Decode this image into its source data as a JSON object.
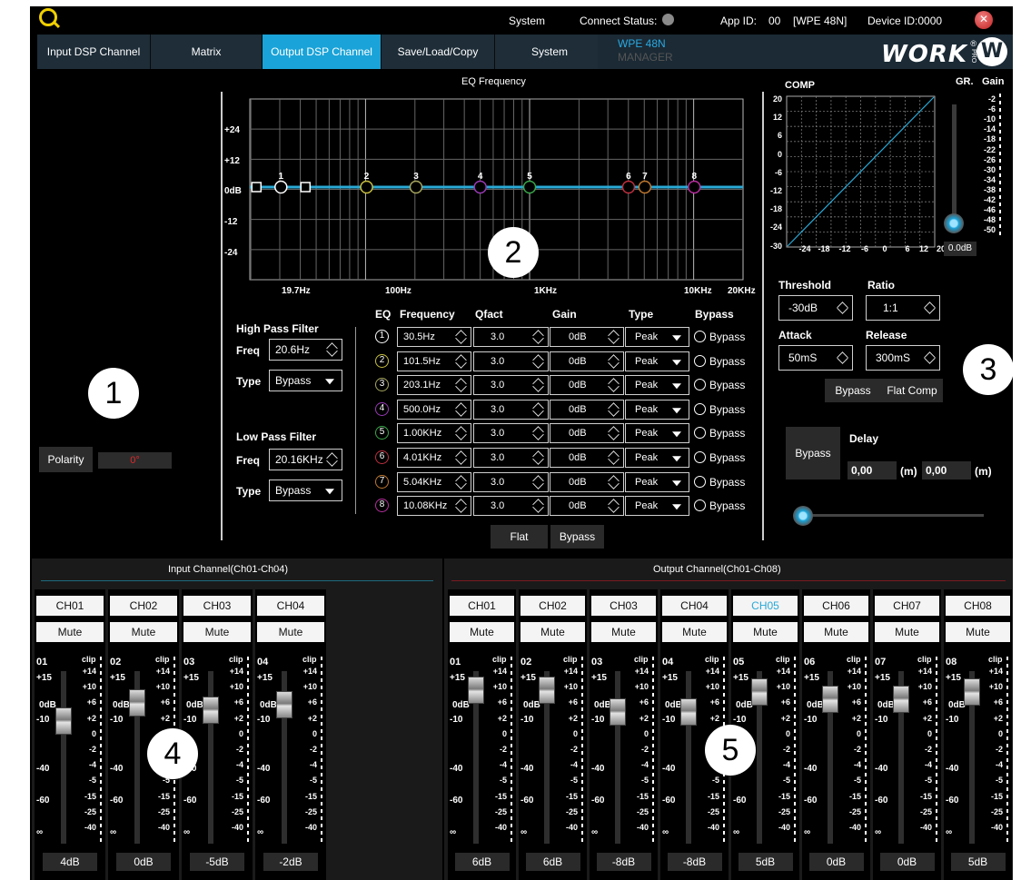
{
  "header": {
    "system_label": "System",
    "connect_status_label": "Connect  Status:",
    "app_id_label": "App ID:",
    "app_id_value": "00",
    "model_value": "[WPE 48N]",
    "device_id_label": "Device ID:0000",
    "close_glyph": "✕",
    "connect_status_color": "#8a8a8a"
  },
  "tabs": [
    {
      "label": "Input DSP Channel"
    },
    {
      "label": "Matrix"
    },
    {
      "label": "Output DSP Channel"
    },
    {
      "label": "Save/Load/Copy"
    },
    {
      "label": "System"
    }
  ],
  "active_tab": "Output DSP Channel",
  "product": {
    "name": "WPE 48N",
    "subtitle": "MANAGER",
    "brand": "WORK",
    "brand_pro": "PRO",
    "brand_reg": "®",
    "brand_badge": "W"
  },
  "colors": {
    "accent": "#1aa3d8",
    "eq_curve": "#29a9d6",
    "active_channel": "#29a9d6"
  },
  "callouts": [
    "1",
    "2",
    "3",
    "4",
    "5"
  ],
  "polarity": {
    "label": "Polarity",
    "value": "0°"
  },
  "eq_graph": {
    "title": "EQ Frequency",
    "y_labels": [
      "+24",
      "+12",
      "0dB",
      "-12",
      "-24"
    ],
    "x_labels": [
      "19.7Hz",
      "100Hz",
      "1KHz",
      "10KHz",
      "20KHz"
    ]
  },
  "high_pass": {
    "title": "High Pass Filter",
    "freq_label": "Freq",
    "freq": "20.6Hz",
    "type_label": "Type",
    "type": "Bypass"
  },
  "low_pass": {
    "title": "Low Pass Filter",
    "freq_label": "Freq",
    "freq": "20.16KHz",
    "type_label": "Type",
    "type": "Bypass"
  },
  "eq_table": {
    "headers": {
      "eq": "EQ",
      "frequency": "Frequency",
      "qfact": "Qfact",
      "gain": "Gain",
      "type": "Type",
      "bypass": "Bypass"
    },
    "bypass_label": "Bypass",
    "bands": [
      {
        "num": "1",
        "freq": "30.5Hz",
        "q": "3.0",
        "gain": "0dB",
        "type": "Peak",
        "color": "#ffffff"
      },
      {
        "num": "2",
        "freq": "101.5Hz",
        "q": "3.0",
        "gain": "0dB",
        "type": "Peak",
        "color": "#c8c040"
      },
      {
        "num": "3",
        "freq": "203.1Hz",
        "q": "3.0",
        "gain": "0dB",
        "type": "Peak",
        "color": "#a8a860"
      },
      {
        "num": "4",
        "freq": "500.0Hz",
        "q": "3.0",
        "gain": "0dB",
        "type": "Peak",
        "color": "#9a3ab8"
      },
      {
        "num": "5",
        "freq": "1.00KHz",
        "q": "3.0",
        "gain": "0dB",
        "type": "Peak",
        "color": "#3aa84a"
      },
      {
        "num": "6",
        "freq": "4.01KHz",
        "q": "3.0",
        "gain": "0dB",
        "type": "Peak",
        "color": "#c03040"
      },
      {
        "num": "7",
        "freq": "5.04KHz",
        "q": "3.0",
        "gain": "0dB",
        "type": "Peak",
        "color": "#c07830"
      },
      {
        "num": "8",
        "freq": "10.08KHz",
        "q": "3.0",
        "gain": "0dB",
        "type": "Peak",
        "color": "#b82fa0"
      }
    ],
    "flat_label": "Flat",
    "bypass_button": "Bypass"
  },
  "comp": {
    "title": "COMP",
    "y_labels": [
      "20",
      "12",
      "6",
      "0",
      "-6",
      "-12",
      "-18",
      "-24",
      "-30"
    ],
    "x_labels": [
      "-24",
      "-18",
      "-12",
      "-6",
      "0",
      "6",
      "12",
      "20"
    ],
    "gr_label": "GR.",
    "gain_label": "Gain",
    "gain_scale": [
      "-2",
      "-6",
      "-10",
      "-14",
      "-18",
      "-22",
      "-26",
      "-30",
      "-34",
      "-38",
      "-42",
      "-46",
      "-48",
      "-50"
    ],
    "gain_value": "0.0dB",
    "gain_fraction": 0.0,
    "threshold_label": "Threshold",
    "threshold": "-30dB",
    "ratio_label": "Ratio",
    "ratio": "1:1",
    "attack_label": "Attack",
    "attack": "50mS",
    "release_label": "Release",
    "release": "300mS",
    "bypass_label": "Bypass",
    "flat_comp_label": "Flat Comp"
  },
  "delay": {
    "bypass_label": "Bypass",
    "label": "Delay",
    "value1": "0,00",
    "unit1": "(m)",
    "value2": "0,00",
    "unit2": "(m)",
    "slider_fraction": 0.0
  },
  "fader_scale": {
    "left": [
      "+15",
      "0dB",
      "-10",
      "-40",
      "-60",
      "∞"
    ],
    "clip_label": "clip",
    "meter": [
      "+14",
      "+10",
      "+6",
      "+2",
      "0",
      "-2",
      "-4",
      "-5",
      "-15",
      "-25",
      "-40"
    ]
  },
  "input_section": {
    "title": "Input Channel(Ch01-Ch04)",
    "channels": [
      {
        "name": "CH01",
        "mute": "Mute",
        "num": "01",
        "level": "4dB"
      },
      {
        "name": "CH02",
        "mute": "Mute",
        "num": "02",
        "level": "0dB"
      },
      {
        "name": "CH03",
        "mute": "Mute",
        "num": "03",
        "level": "-5dB"
      },
      {
        "name": "CH04",
        "mute": "Mute",
        "num": "04",
        "level": "-2dB"
      }
    ]
  },
  "output_section": {
    "title": "Output Channel(Ch01-Ch08)",
    "channels": [
      {
        "name": "CH01",
        "mute": "Mute",
        "num": "01",
        "level": "6dB"
      },
      {
        "name": "CH02",
        "mute": "Mute",
        "num": "02",
        "level": "6dB"
      },
      {
        "name": "CH03",
        "mute": "Mute",
        "num": "03",
        "level": "-8dB"
      },
      {
        "name": "CH04",
        "mute": "Mute",
        "num": "04",
        "level": "-8dB"
      },
      {
        "name": "CH05",
        "mute": "Mute",
        "num": "05",
        "level": "5dB",
        "active": true
      },
      {
        "name": "CH06",
        "mute": "Mute",
        "num": "06",
        "level": "0dB"
      },
      {
        "name": "CH07",
        "mute": "Mute",
        "num": "07",
        "level": "0dB"
      },
      {
        "name": "CH08",
        "mute": "Mute",
        "num": "08",
        "level": "5dB"
      }
    ]
  }
}
